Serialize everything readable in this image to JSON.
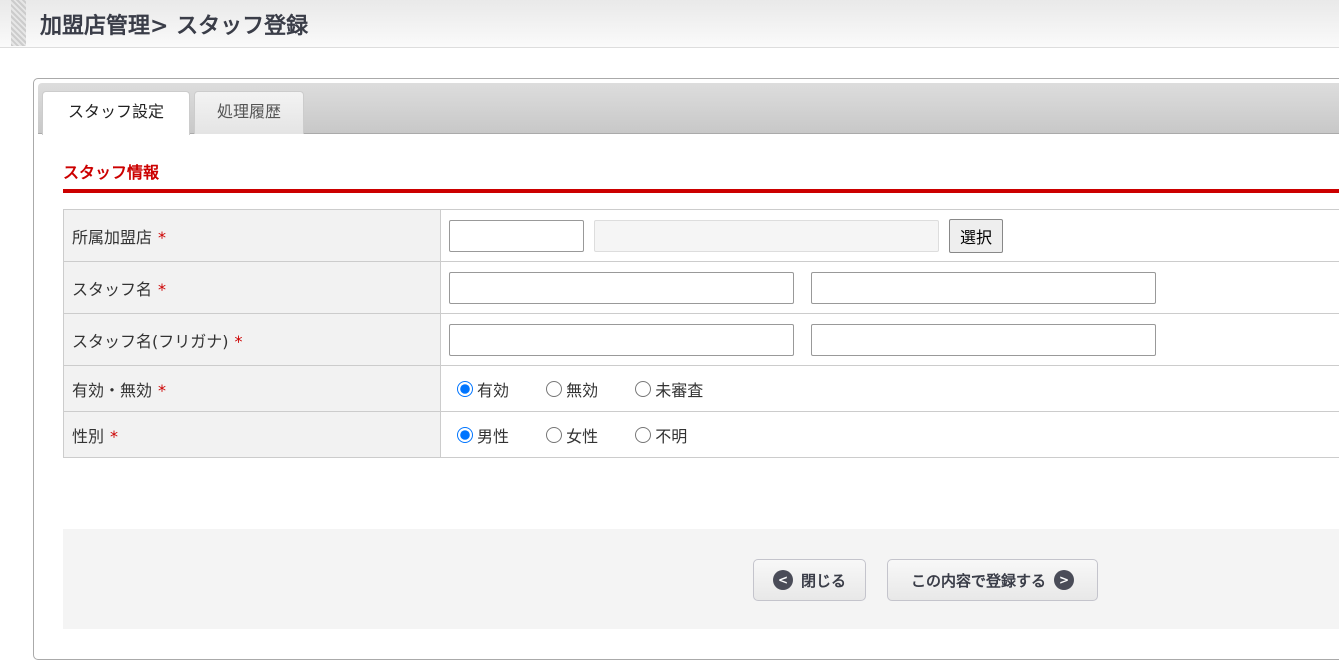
{
  "header": {
    "title": "加盟店管理> スタッフ登録"
  },
  "tabs": [
    {
      "label": "スタッフ設定"
    },
    {
      "label": "処理履歴"
    }
  ],
  "section": {
    "title": "スタッフ情報"
  },
  "form": {
    "required_mark": "*",
    "store_label": "所属加盟店",
    "select_button": "選択",
    "staff_name_label": "スタッフ名",
    "staff_kana_label": "スタッフ名(フリガナ)",
    "status_label": "有効・無効",
    "status_options": [
      "有効",
      "無効",
      "未審査"
    ],
    "gender_label": "性別",
    "gender_options": [
      "男性",
      "女性",
      "不明"
    ]
  },
  "footer": {
    "close": "閉じる",
    "submit": "この内容で登録する"
  }
}
